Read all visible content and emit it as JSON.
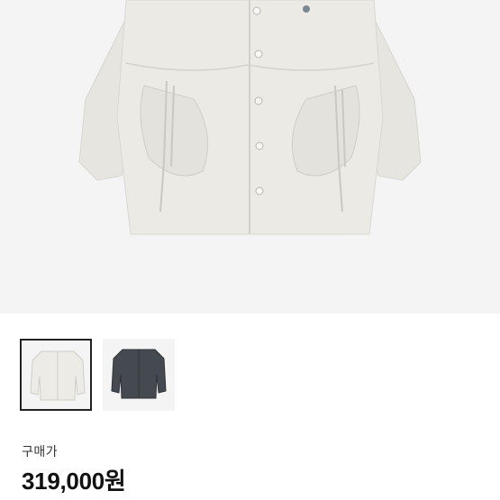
{
  "product": {
    "price_label": "구매가",
    "price": "319,000원",
    "thumbnails": [
      {
        "color": "ivory",
        "swatch": "#ecebe6",
        "selected": true
      },
      {
        "color": "charcoal",
        "swatch": "#454a50",
        "selected": false
      }
    ]
  },
  "colors": {
    "hero_background": "#f4f4f4",
    "selected_border": "#222222"
  }
}
